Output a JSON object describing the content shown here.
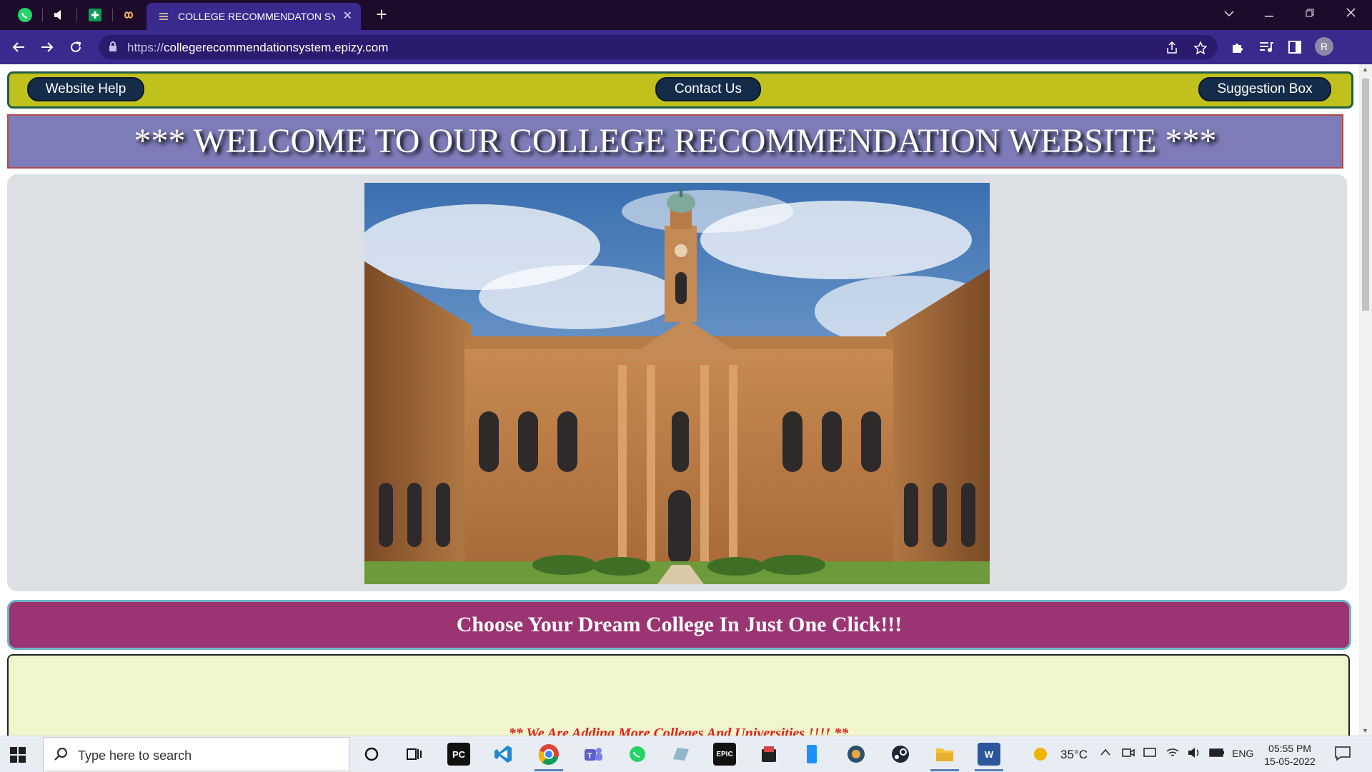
{
  "browser": {
    "active_tab_title": "COLLEGE RECOMMENDATON SYSTEM",
    "tab_close": "✕",
    "new_tab": "+",
    "url_host": "collegerecommendationsystem.epizy.com",
    "url_scheme": "https://",
    "profile_initial": "R"
  },
  "page": {
    "nav": {
      "website_help": "Website Help",
      "contact_us": "Contact Us",
      "suggestion_box": "Suggestion Box"
    },
    "welcome_text": "*** WELCOME TO OUR COLLEGE RECOMMENDATION WEBSITE ***",
    "hero_image_description": "college-building-photo",
    "cta_text": "Choose Your Dream College In Just One Click!!!",
    "notice_text": "** We Are Adding More Colleges And Universities !!!! **",
    "colors": {
      "nav_bar": "#c1c11e",
      "nav_button": "#142c49",
      "welcome_bg": "#7e7cb8",
      "cta_bg": "#9b3473",
      "panel_bg": "#f1f5cc",
      "notice": "#e0201d"
    }
  },
  "taskbar": {
    "search_placeholder": "Type here to search",
    "weather": "35°C",
    "language": "ENG",
    "time": "05:55 PM",
    "date": "15-05-2022",
    "apps": [
      "cortana-icon",
      "task-view-icon",
      "pycharm-icon",
      "vscode-icon",
      "chrome-icon",
      "teams-icon",
      "whatsapp-icon",
      "app-icon",
      "epic-games-icon",
      "app-icon",
      "phone-icon",
      "app-icon",
      "steam-icon",
      "file-explorer-icon",
      "word-icon"
    ]
  }
}
